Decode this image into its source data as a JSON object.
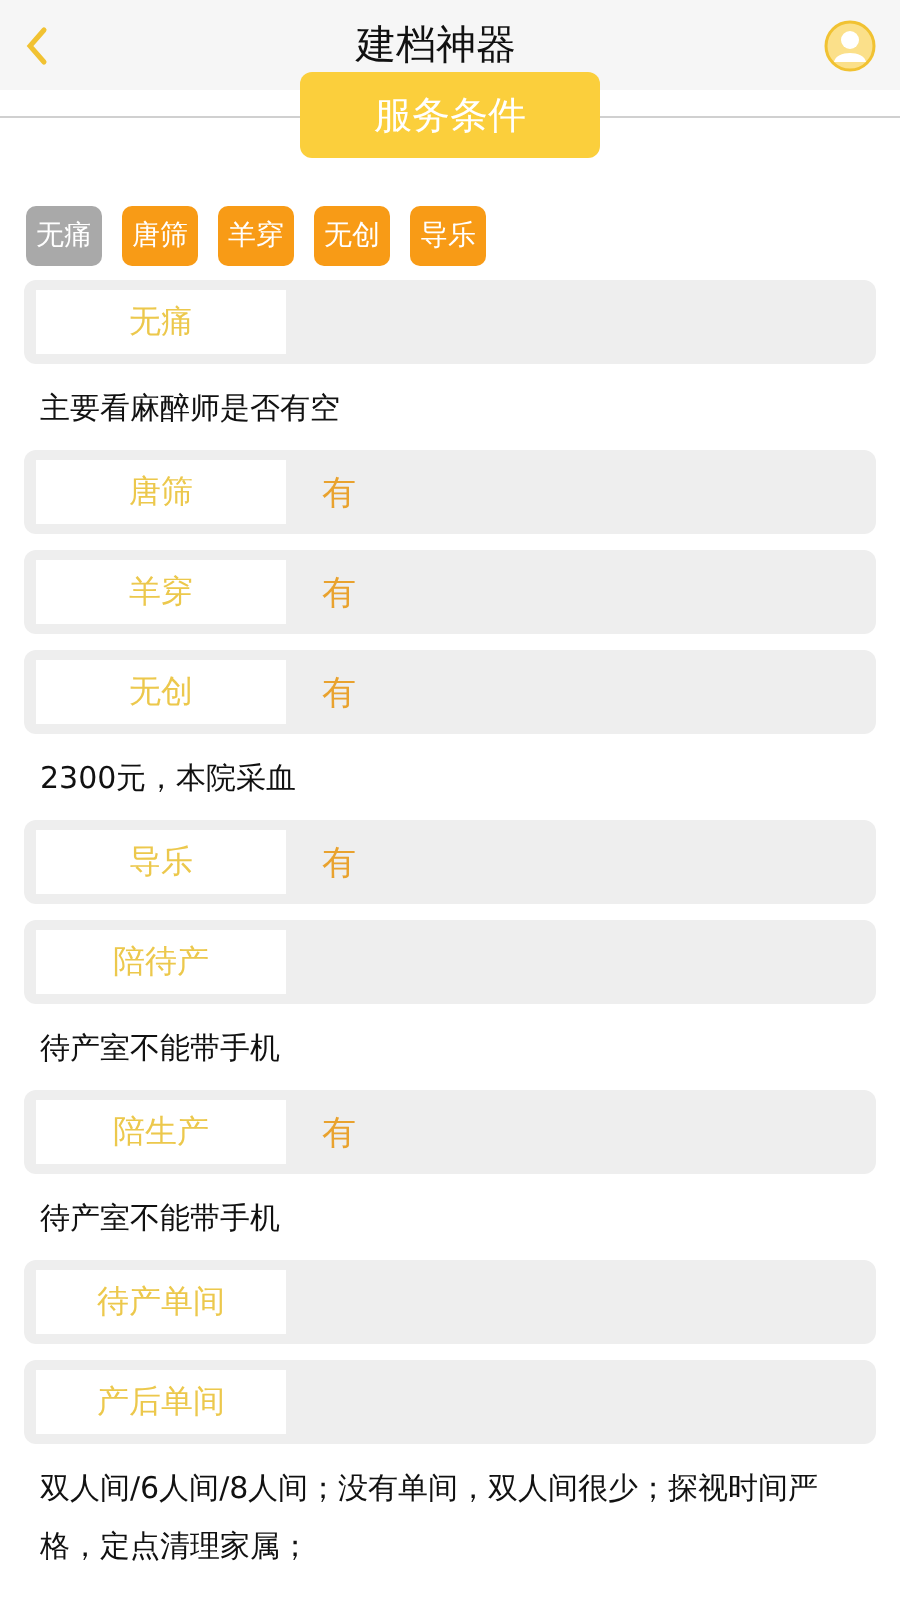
{
  "header": {
    "title": "建档神器"
  },
  "section_button": {
    "label": "服务条件"
  },
  "tags": [
    {
      "label": "无痛",
      "selected": true
    },
    {
      "label": "唐筛",
      "selected": false
    },
    {
      "label": "羊穿",
      "selected": false
    },
    {
      "label": "无创",
      "selected": false
    },
    {
      "label": "导乐",
      "selected": false
    }
  ],
  "items": [
    {
      "label": "无痛",
      "note": "主要看麻醉师是否有空"
    },
    {
      "label": "唐筛",
      "value": "有"
    },
    {
      "label": "羊穿",
      "value": "有"
    },
    {
      "label": "无创",
      "value": "有",
      "note": "2300元，本院采血"
    },
    {
      "label": "导乐",
      "value": "有"
    },
    {
      "label": "陪待产",
      "note": "待产室不能带手机"
    },
    {
      "label": "陪生产",
      "value": "有",
      "note": "待产室不能带手机"
    },
    {
      "label": "待产单间"
    },
    {
      "label": "产后单间",
      "note": "双人间/6人间/8人间；没有单间，双人间很少；探视时间严格，定点清理家属；"
    }
  ]
}
